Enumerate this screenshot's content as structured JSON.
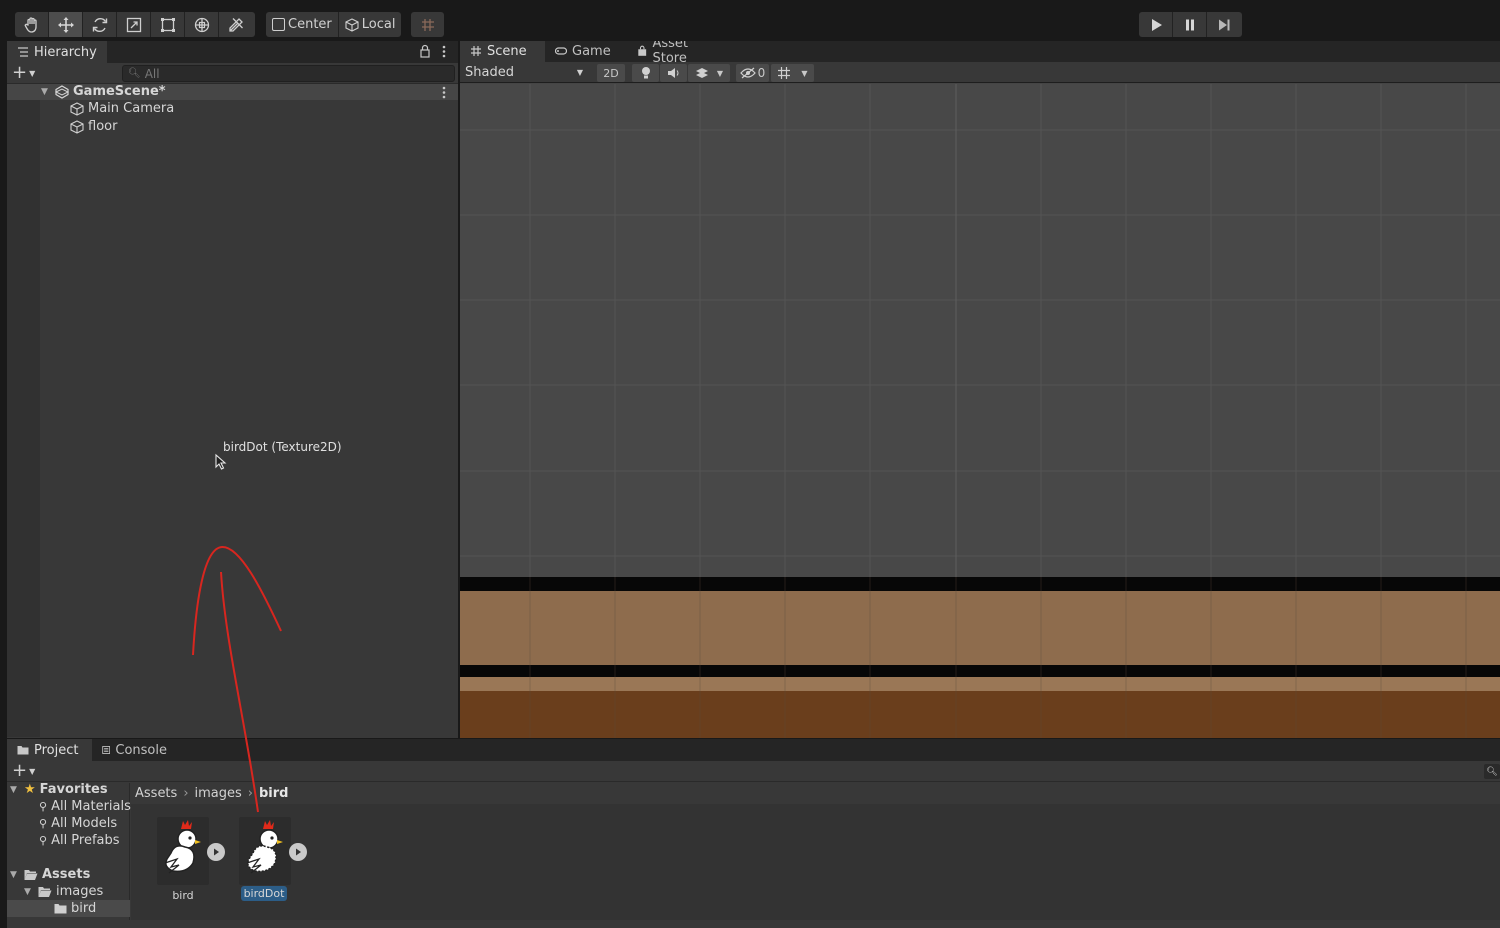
{
  "toolbar": {
    "tools": [
      "hand-tool-icon",
      "move-tool-icon",
      "rotate-tool-icon",
      "scale-tool-icon",
      "rect-tool-icon",
      "transform-tool-icon",
      "custom-tool-icon"
    ],
    "pivot_label": "Center",
    "space_label": "Local",
    "playback": [
      "play-icon",
      "pause-icon",
      "step-icon"
    ]
  },
  "hierarchy": {
    "tab_label": "Hierarchy",
    "search_placeholder": "All",
    "scene_name": "GameScene*",
    "items": [
      "Main Camera",
      "floor"
    ],
    "drag_tooltip": "birdDot (Texture2D)"
  },
  "scene": {
    "tabs": [
      "Scene",
      "Game",
      "Asset Store"
    ],
    "shading_mode": "Shaded",
    "toggle_2d": "2D",
    "hidden_count": "0",
    "colors": {
      "viewport": "#484848",
      "floor_light": "#8e6c4d",
      "floor_dark": "#6a3e1c",
      "floor_stripe": "#9a7756"
    }
  },
  "project": {
    "tabs": [
      "Project",
      "Console"
    ],
    "favorites_label": "Favorites",
    "favorites": [
      "All Materials",
      "All Models",
      "All Prefabs"
    ],
    "assets_label": "Assets",
    "folders": [
      "images",
      "bird"
    ],
    "breadcrumb": [
      "Assets",
      "images",
      "bird"
    ],
    "assets": [
      {
        "name": "bird",
        "selected": false
      },
      {
        "name": "birdDot",
        "selected": true
      }
    ]
  }
}
